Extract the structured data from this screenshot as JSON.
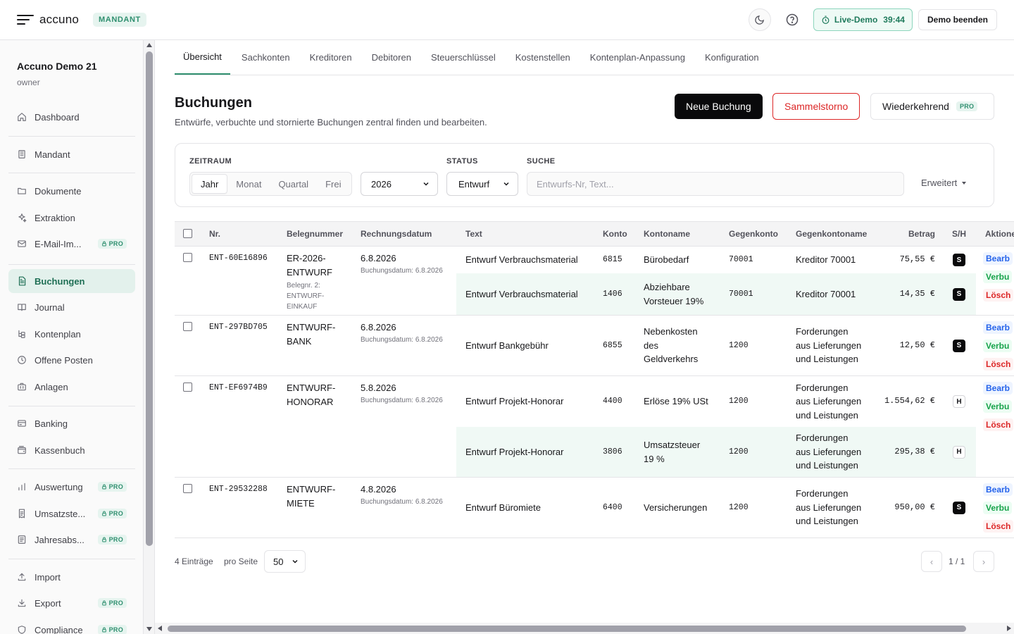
{
  "topbar": {
    "brand": "accuno",
    "badge": "MANDANT",
    "live_demo_label": "Live-Demo",
    "live_demo_timer": "39:44",
    "end_demo": "Demo beenden"
  },
  "sidebar": {
    "org_name": "Accuno Demo 21",
    "org_role": "owner",
    "pro_label": "PRO",
    "items": [
      {
        "label": "Dashboard",
        "icon": "home-icon",
        "pro": false,
        "active": false
      },
      {
        "label": "Mandant",
        "icon": "building-icon",
        "pro": false,
        "active": false
      },
      {
        "label": "Dokumente",
        "icon": "folder-icon",
        "pro": false,
        "active": false
      },
      {
        "label": "Extraktion",
        "icon": "sparkles-icon",
        "pro": false,
        "active": false
      },
      {
        "label": "E-Mail-Im...",
        "icon": "mail-icon",
        "pro": true,
        "active": false
      },
      {
        "label": "Buchungen",
        "icon": "file-text-icon",
        "pro": false,
        "active": true
      },
      {
        "label": "Journal",
        "icon": "book-icon",
        "pro": false,
        "active": false
      },
      {
        "label": "Kontenplan",
        "icon": "tree-icon",
        "pro": false,
        "active": false
      },
      {
        "label": "Offene Posten",
        "icon": "clock-icon",
        "pro": false,
        "active": false
      },
      {
        "label": "Anlagen",
        "icon": "briefcase-icon",
        "pro": false,
        "active": false
      },
      {
        "label": "Banking",
        "icon": "bank-icon",
        "pro": false,
        "active": false
      },
      {
        "label": "Kassenbuch",
        "icon": "wallet-icon",
        "pro": false,
        "active": false
      },
      {
        "label": "Auswertung",
        "icon": "bar-chart-icon",
        "pro": true,
        "active": false
      },
      {
        "label": "Umsatzste...",
        "icon": "receipt-icon",
        "pro": true,
        "active": false
      },
      {
        "label": "Jahresabs...",
        "icon": "calendar-icon",
        "pro": true,
        "active": false
      },
      {
        "label": "Import",
        "icon": "upload-icon",
        "pro": false,
        "active": false
      },
      {
        "label": "Export",
        "icon": "download-icon",
        "pro": true,
        "active": false
      },
      {
        "label": "Compliance",
        "icon": "shield-icon",
        "pro": true,
        "active": false
      }
    ]
  },
  "tabs": [
    "Übersicht",
    "Sachkonten",
    "Kreditoren",
    "Debitoren",
    "Steuerschlüssel",
    "Kostenstellen",
    "Kontenplan-Anpassung",
    "Konfiguration"
  ],
  "page": {
    "title": "Buchungen",
    "subtitle": "Entwürfe, verbuchte und stornierte Buchungen zentral finden und bearbeiten.",
    "btn_new": "Neue Buchung",
    "btn_storno": "Sammelstorno",
    "btn_recurring": "Wiederkehrend"
  },
  "filters": {
    "period_label": "ZEITRAUM",
    "period_options": [
      "Jahr",
      "Monat",
      "Quartal",
      "Frei"
    ],
    "year": "2026",
    "status_label": "STATUS",
    "status_value": "Entwurf",
    "search_label": "SUCHE",
    "search_placeholder": "Entwurfs-Nr, Text...",
    "advanced": "Erweitert"
  },
  "table": {
    "headers": {
      "nr": "Nr.",
      "beleg": "Belegnummer",
      "datum": "Rechnungsdatum",
      "text": "Text",
      "konto": "Konto",
      "kontoname": "Kontoname",
      "gegenkonto": "Gegenkonto",
      "gegenkontoname": "Gegenkontoname",
      "betrag": "Betrag",
      "sh": "S/H",
      "aktionen": "Aktione"
    },
    "actions": {
      "edit": "Bearb",
      "book": "Verbu",
      "delete": "Lösch"
    },
    "groups": [
      {
        "nr": "ENT-60E16896",
        "beleg_lines": [
          "ER-2026-",
          "ENTWURF"
        ],
        "beleg2_lines": [
          "Belegnr. 2:",
          "ENTWURF-",
          "EINKAUF"
        ],
        "datum": "6.8.2026",
        "buchungsdatum": "Buchungsdatum: 6.8.2026",
        "lines": [
          {
            "text": "Entwurf Verbrauchsmaterial",
            "konto": "6815",
            "kontoname_lines": [
              "Bürobedarf"
            ],
            "gegenkonto": "70001",
            "gegenkontoname_lines": [
              "Kreditor 70001"
            ],
            "betrag": "75,55 €",
            "sh": "S"
          },
          {
            "text": "Entwurf Verbrauchsmaterial",
            "konto": "1406",
            "kontoname_lines": [
              "Abziehbare",
              "Vorsteuer 19%"
            ],
            "gegenkonto": "70001",
            "gegenkontoname_lines": [
              "Kreditor 70001"
            ],
            "betrag": "14,35 €",
            "sh": "S"
          }
        ]
      },
      {
        "nr": "ENT-297BD705",
        "beleg_lines": [
          "ENTWURF-",
          "BANK"
        ],
        "beleg2_lines": [],
        "datum": "6.8.2026",
        "buchungsdatum": "Buchungsdatum: 6.8.2026",
        "lines": [
          {
            "text": "Entwurf Bankgebühr",
            "konto": "6855",
            "kontoname_lines": [
              "Nebenkosten",
              "des",
              "Geldverkehrs"
            ],
            "gegenkonto": "1200",
            "gegenkontoname_lines": [
              "Forderungen",
              "aus Lieferungen",
              "und Leistungen"
            ],
            "betrag": "12,50 €",
            "sh": "S"
          }
        ]
      },
      {
        "nr": "ENT-EF6974B9",
        "beleg_lines": [
          "ENTWURF-",
          "HONORAR"
        ],
        "beleg2_lines": [],
        "datum": "5.8.2026",
        "buchungsdatum": "Buchungsdatum: 6.8.2026",
        "lines": [
          {
            "text": "Entwurf Projekt-Honorar",
            "konto": "4400",
            "kontoname_lines": [
              "Erlöse 19% USt"
            ],
            "gegenkonto": "1200",
            "gegenkontoname_lines": [
              "Forderungen",
              "aus Lieferungen",
              "und Leistungen"
            ],
            "betrag": "1.554,62 €",
            "sh": "H"
          },
          {
            "text": "Entwurf Projekt-Honorar",
            "konto": "3806",
            "kontoname_lines": [
              "Umsatzsteuer",
              "19 %"
            ],
            "gegenkonto": "1200",
            "gegenkontoname_lines": [
              "Forderungen",
              "aus Lieferungen",
              "und Leistungen"
            ],
            "betrag": "295,38 €",
            "sh": "H"
          }
        ]
      },
      {
        "nr": "ENT-29532288",
        "beleg_lines": [
          "ENTWURF-",
          "MIETE"
        ],
        "beleg2_lines": [],
        "datum": "4.8.2026",
        "buchungsdatum": "Buchungsdatum: 6.8.2026",
        "lines": [
          {
            "text": "Entwurf Büromiete",
            "konto": "6400",
            "kontoname_lines": [
              "Versicherungen"
            ],
            "gegenkonto": "1200",
            "gegenkontoname_lines": [
              "Forderungen",
              "aus Lieferungen",
              "und Leistungen"
            ],
            "betrag": "950,00 €",
            "sh": "S"
          }
        ]
      }
    ]
  },
  "footer": {
    "entries": "4 Einträge",
    "per_page_label": "pro Seite",
    "per_page_value": "50",
    "page_indicator": "1 / 1",
    "prev": "‹",
    "next": "›"
  }
}
